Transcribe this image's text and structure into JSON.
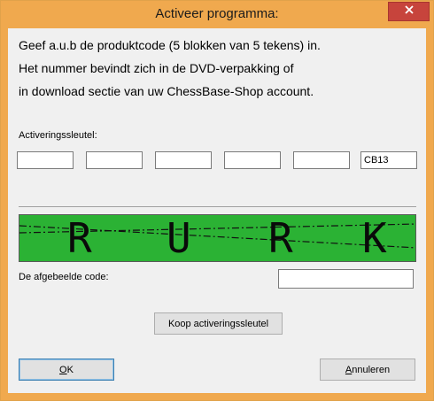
{
  "window": {
    "title": "Activeer programma:"
  },
  "instructions": [
    "Geef a.u.b de produktcode (5 blokken van 5 tekens) in.",
    "Het nummer bevindt zich in de DVD-verpakking of",
    "in download sectie van uw ChessBase-Shop account."
  ],
  "activation": {
    "label": "Activeringssleutel:",
    "blocks": [
      "",
      "",
      "",
      "",
      "",
      "CB13"
    ]
  },
  "captcha": {
    "chars": [
      "R",
      "U",
      "R",
      "K"
    ],
    "label": "De afgebeelde code:",
    "value": ""
  },
  "buttons": {
    "buy": "Koop activeringssleutel",
    "ok": "OK",
    "cancel": "Annuleren"
  },
  "colors": {
    "titlebar": "#f0a94e",
    "close": "#c7443c",
    "captcha_bg": "#2bb234"
  },
  "icons": {
    "close": "close-icon"
  }
}
